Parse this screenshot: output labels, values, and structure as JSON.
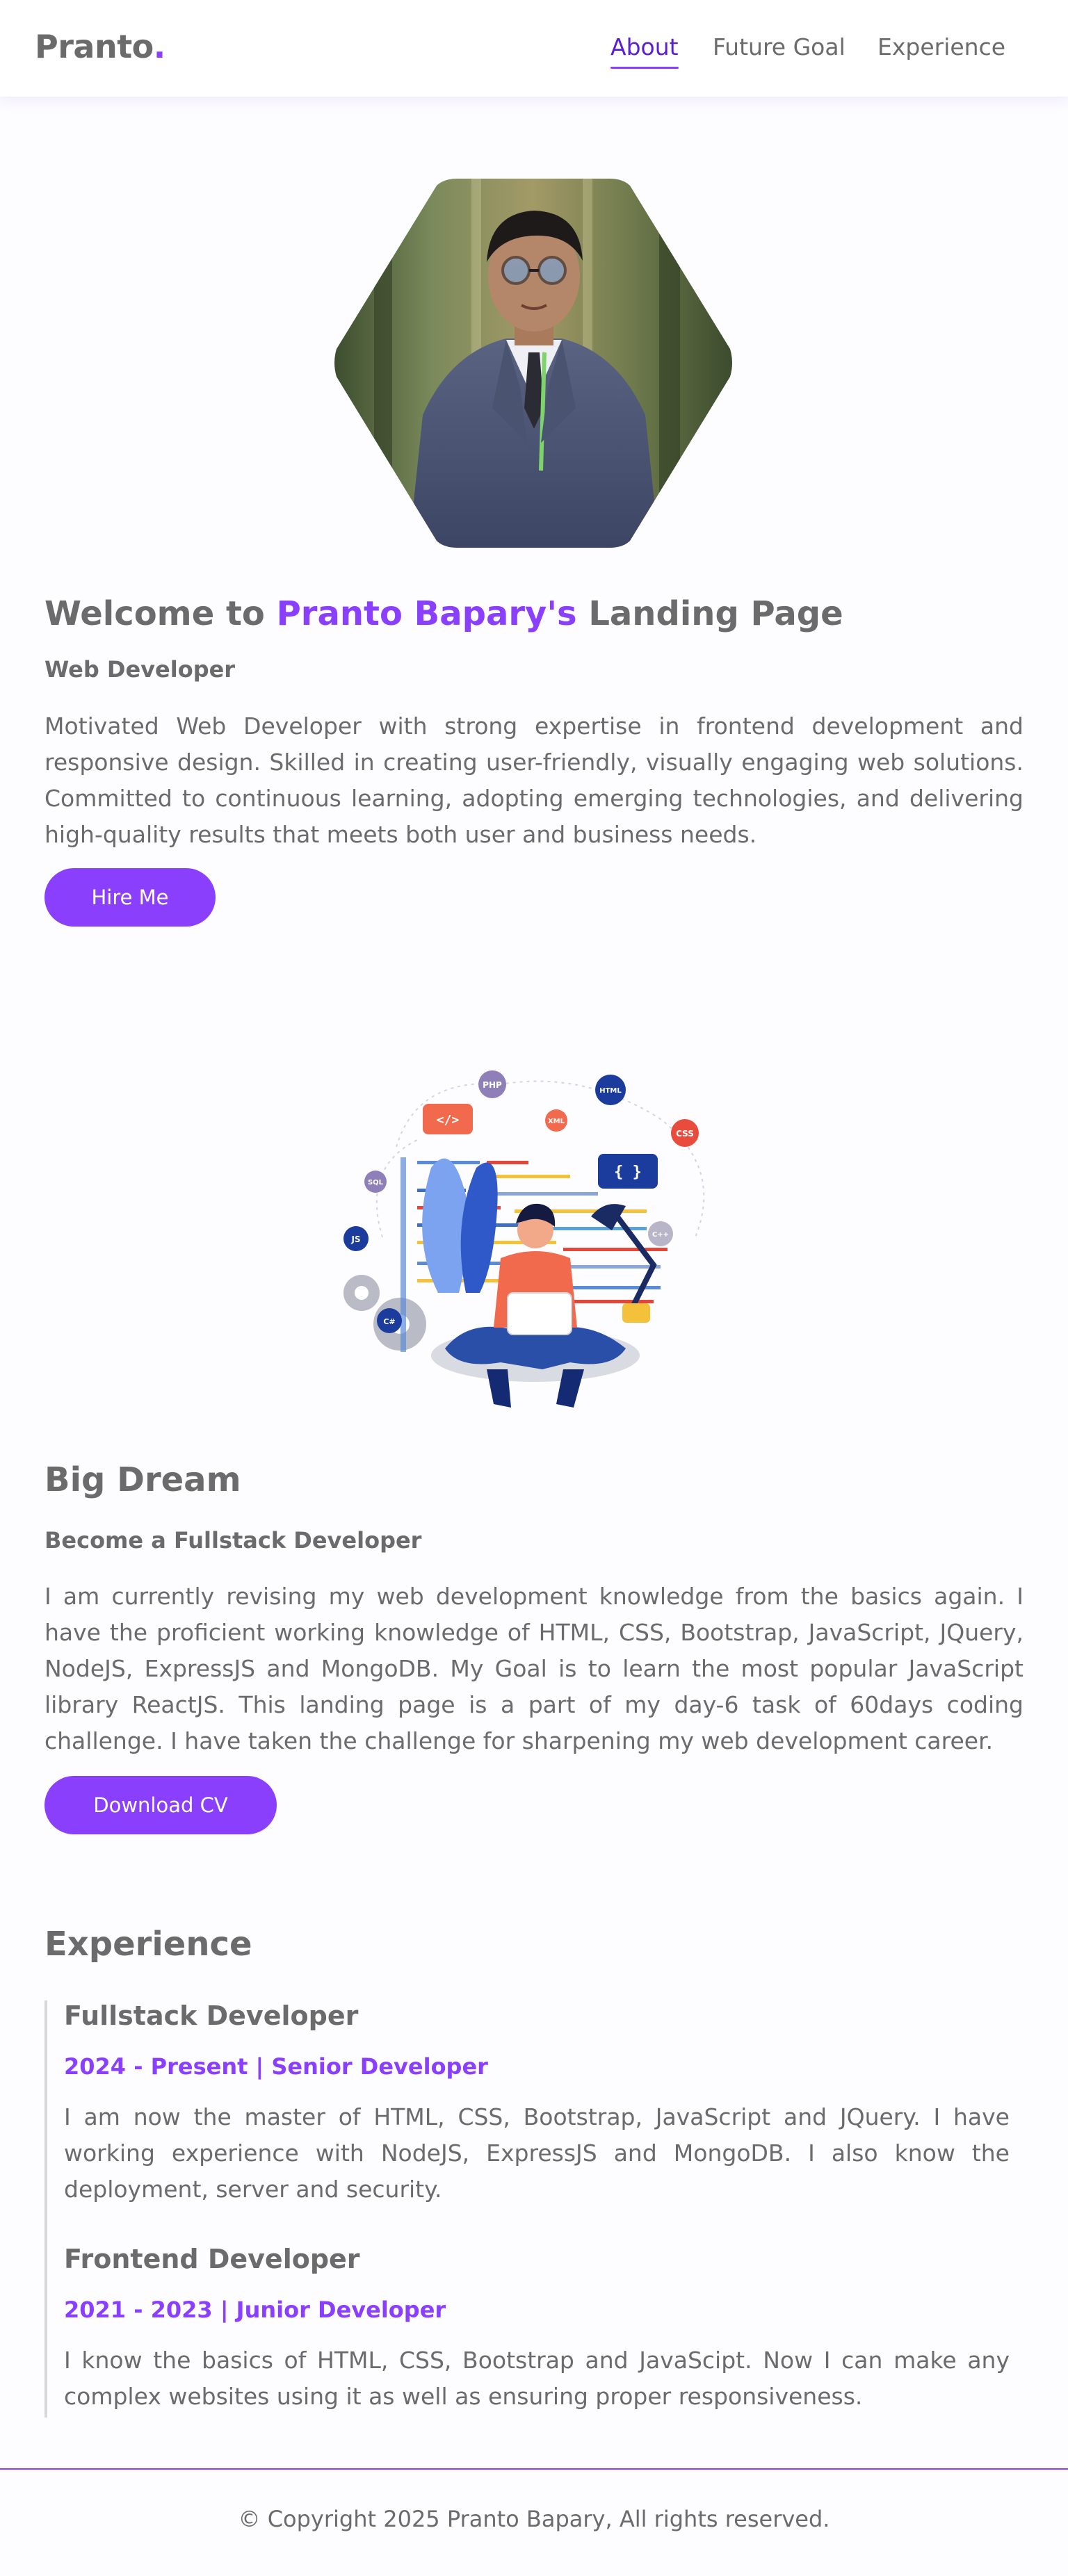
{
  "brand": {
    "name": "Pranto",
    "dot": "."
  },
  "nav": {
    "about": "About",
    "future_goal": "Future Goal",
    "experience": "Experience"
  },
  "hero": {
    "heading_prefix": "Welcome to",
    "heading_name": "Pranto Bapary's",
    "heading_suffix": "Landing Page",
    "role": "Web Developer",
    "bio": "Motivated Web Developer with strong expertise in frontend development and responsive design. Skilled in creating user-friendly, visually engaging web solutions. Committed to continuous learning, adopting emerging technologies, and delivering high-quality results that meets both user and business needs.",
    "hire_button": "Hire Me"
  },
  "dream": {
    "title": "Big Dream",
    "subtitle": "Become a Fullstack Developer",
    "text": "I am currently revising my web development knowledge from the basics again. I have the proficient working knowledge of HTML, CSS, Bootstrap, JavaScript, JQuery, NodeJS, ExpressJS and MongoDB. My Goal is to learn the most popular JavaScript library ReactJS. This landing page is a part of my day-6 task of 60days coding challenge. I have taken the challenge for sharpening my web development career.",
    "cv_button": "Download CV",
    "badges": [
      "PHP",
      "HTML",
      "XML",
      "CSS",
      "SQL",
      "JS",
      "C++",
      "C#",
      "{ }",
      "</>"
    ]
  },
  "experience": {
    "title": "Experience",
    "items": [
      {
        "role": "Fullstack Developer",
        "meta": "2024 - Present | Senior Developer",
        "desc": "I am now the master of HTML, CSS, Bootstrap, JavaScript and JQuery. I have working experience with NodeJS, ExpressJS and MongoDB. I also know the deployment, server and security."
      },
      {
        "role": "Frontend Developer",
        "meta": "2021 - 2023 | Junior Developer",
        "desc": "I know the basics of HTML, CSS, Bootstrap and JavaScipt. Now I can make any complex websites using it as well as ensuring proper responsiveness."
      }
    ]
  },
  "footer": {
    "copyright": "© Copyright 2025 Pranto Bapary, All rights reserved."
  },
  "colors": {
    "accent": "#8a3ffc",
    "text": "#6b6b6b",
    "nav_active": "#5a1fd0"
  }
}
